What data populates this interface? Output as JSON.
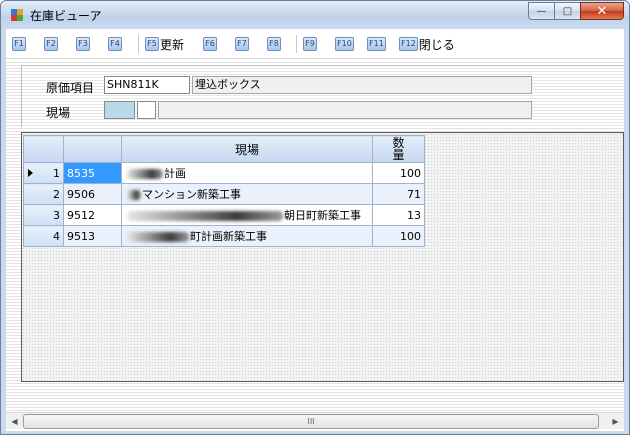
{
  "window": {
    "title": "在庫ビューア",
    "icon": "app-window-icon",
    "minimize_label": "—",
    "maximize_label": "□",
    "close_label": "✕"
  },
  "toolbar": {
    "keys": [
      {
        "key": "F1",
        "label": ""
      },
      {
        "key": "F2",
        "label": ""
      },
      {
        "key": "F3",
        "label": ""
      },
      {
        "key": "F4",
        "label": ""
      },
      {
        "key": "F5",
        "label": "更新"
      },
      {
        "key": "F6",
        "label": ""
      },
      {
        "key": "F7",
        "label": ""
      },
      {
        "key": "F8",
        "label": ""
      },
      {
        "key": "F9",
        "label": ""
      },
      {
        "key": "F10",
        "label": ""
      },
      {
        "key": "F11",
        "label": ""
      },
      {
        "key": "F12",
        "label": "閉じる"
      }
    ]
  },
  "header": {
    "cost_item_label": "原価項目",
    "cost_item_code": "SHN811K",
    "cost_item_name": "埋込ボックス",
    "site_label": "現場",
    "site_code_1": "",
    "site_code_2": "",
    "site_name": ""
  },
  "grid": {
    "columns": [
      "",
      "",
      "現場",
      "数量"
    ],
    "quantity_header_line1": "数",
    "quantity_header_line2": "量",
    "rows": [
      {
        "no": "1",
        "code": "8535",
        "site": "計画",
        "qty": "100",
        "current": true
      },
      {
        "no": "2",
        "code": "9506",
        "site": "マンション新築工事",
        "qty": "71",
        "current": false
      },
      {
        "no": "3",
        "code": "9512",
        "site": "朝日町新築工事",
        "qty": "13",
        "current": false
      },
      {
        "no": "4",
        "code": "9513",
        "site": "町計画新築工事",
        "qty": "100",
        "current": false
      }
    ]
  },
  "scrollbar": {
    "left_arrow": "◀",
    "right_arrow": "▶",
    "thumb_grip": "III"
  },
  "colors": {
    "selection": "#3399ff",
    "header_gradient_top": "#e4edf9",
    "header_gradient_bottom": "#c5d8f1",
    "close_button": "#c4391b"
  }
}
